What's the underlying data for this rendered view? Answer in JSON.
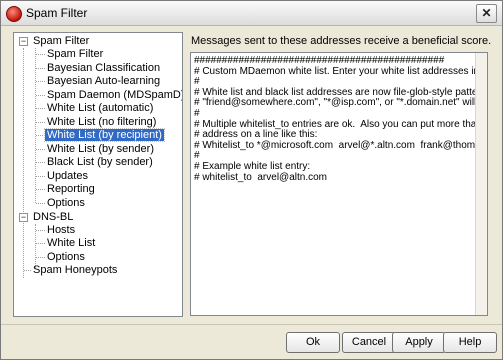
{
  "window": {
    "title": "Spam Filter",
    "close_glyph": "✕"
  },
  "tree": {
    "root": "Spam Filter",
    "items": [
      "Spam Filter",
      "Bayesian Classification",
      "Bayesian Auto-learning",
      "Spam Daemon (MDSpamD)",
      "White List (automatic)",
      "White List (no filtering)",
      "White List (by recipient)",
      "White List (by sender)",
      "Black List (by sender)",
      "Updates",
      "Reporting",
      "Options"
    ],
    "dnsbl": "DNS-BL",
    "dnsbl_items": [
      "Hosts",
      "White List",
      "Options"
    ],
    "honeypots": "Spam Honeypots",
    "expander_glyph": "−"
  },
  "description": "Messages sent to these addresses receive a beneficial score.",
  "editor": {
    "text": "#############################################\n# Custom MDaemon white list. Enter your white list addresses into this file.\n#\n# White list and black list addresses are now file-glob-style patterns, so\n# \"friend@somewhere.com\", \"*@isp.com\", or \"*.domain.net\" will all work.\n#\n# Multiple whitelist_to entries are ok.  Also you can put more than one\n# address on a line like this:\n# Whitelist_to *@microsoft.com  arvel@*.altn.com  frank@thomas.com\n#\n# Example white list entry:\n# whitelist_to  arvel@altn.com"
  },
  "buttons": {
    "ok": "Ok",
    "cancel": "Cancel",
    "apply": "Apply",
    "help": "Help"
  },
  "colors": {
    "selection": "#316ac5",
    "dialog_bg": "#ece9d8"
  }
}
